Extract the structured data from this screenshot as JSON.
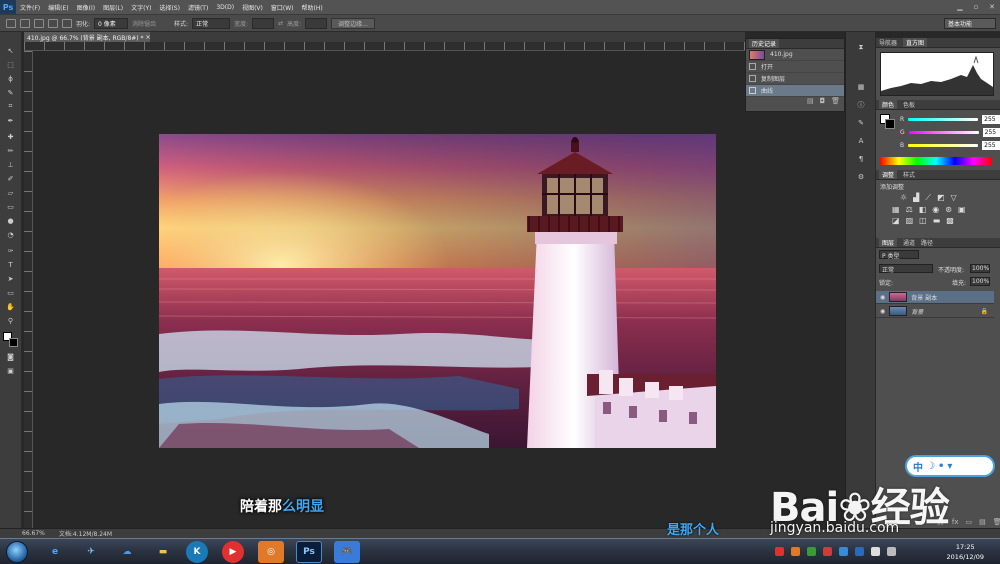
{
  "app": {
    "logo": "Ps"
  },
  "menu": [
    "文件(F)",
    "编辑(E)",
    "图像(I)",
    "图层(L)",
    "文字(Y)",
    "选择(S)",
    "滤镜(T)",
    "3D(D)",
    "视图(V)",
    "窗口(W)",
    "帮助(H)"
  ],
  "options": {
    "feather_label": "羽化:",
    "feather_value": "0 像素",
    "antialias": "消除锯齿",
    "style_label": "样式:",
    "style_value": "正常",
    "width_label": "宽度:",
    "height_label": "高度:",
    "refine_edge": "调整边缘...",
    "workspace": "基本功能"
  },
  "document": {
    "tab_title": "410.jpg @ 66.7% (背景 副本, RGB/8#) *",
    "close": "×"
  },
  "history": {
    "tabs": [
      "历史记录"
    ],
    "snapshot": "410.jpg",
    "items": [
      "打开",
      "复制图层",
      "曲线"
    ]
  },
  "navigator": {
    "tabs": [
      "导航器",
      "直方图"
    ]
  },
  "color_panel": {
    "tabs": [
      "颜色",
      "色板"
    ],
    "r_label": "R",
    "g_label": "G",
    "b_label": "B",
    "r": "255",
    "g": "255",
    "b": "255"
  },
  "adjustments": {
    "tabs": [
      "调整",
      "样式"
    ],
    "title": "添加调整"
  },
  "layers": {
    "tabs": [
      "图层",
      "通道",
      "路径"
    ],
    "kind": "P 类型",
    "blend": "正常",
    "opacity_label": "不透明度:",
    "opacity": "100%",
    "lock_label": "锁定:",
    "fill_label": "填充:",
    "fill": "100%",
    "rows": [
      {
        "name": "背景 副本",
        "selected": true
      },
      {
        "name": "背景",
        "selected": false
      }
    ]
  },
  "status": {
    "zoom": "66.67%",
    "doc": "文档:4.12M/8.24M"
  },
  "taskbar": {
    "time": "17:25",
    "date": "2016/12/09",
    "ps": "Ps"
  },
  "subtitles": {
    "line1_a": "陪着那",
    "line1_b": "么明显",
    "line2": "是那个人"
  },
  "watermark": {
    "brand": "Bai",
    "brand2": "经验",
    "url": "jingyan.baidu.com"
  },
  "ime": {
    "label": "中"
  }
}
